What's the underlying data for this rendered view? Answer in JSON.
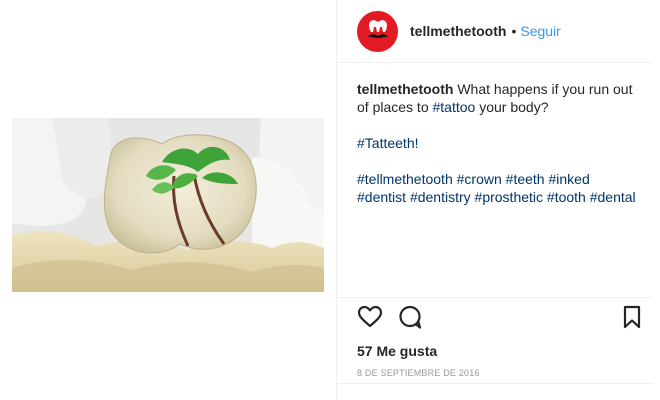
{
  "post": {
    "username": "tellmethetooth",
    "separator": "•",
    "follow_label": "Seguir",
    "caption": {
      "username": "tellmethetooth",
      "text_before": " What happens if you run out of places to ",
      "inline_tag": "#tattoo",
      "text_after": " your body?",
      "tag_line_1": "#Tatteeth!",
      "tags": [
        "#tellmethetooth",
        "#crown",
        "#teeth",
        "#inked",
        "#dentist",
        "#dentistry",
        "#prosthetic",
        "#tooth",
        "#dental"
      ]
    },
    "likes_label": "57 Me gusta",
    "date_label": "8 DE SEPTIEMBRE DE 2016"
  },
  "icons": {
    "avatar": "tooth-mustache-logo-icon",
    "like": "heart-icon",
    "comment": "comment-bubble-icon",
    "save": "bookmark-icon"
  },
  "colors": {
    "avatar_bg": "#e21b23",
    "follow": "#3897f0",
    "hashtag": "#003569",
    "text": "#262626",
    "muted": "#999999",
    "palm_leaves": "#3fa33a"
  },
  "image": {
    "subject": "dental crown with palm tree tattoo"
  }
}
